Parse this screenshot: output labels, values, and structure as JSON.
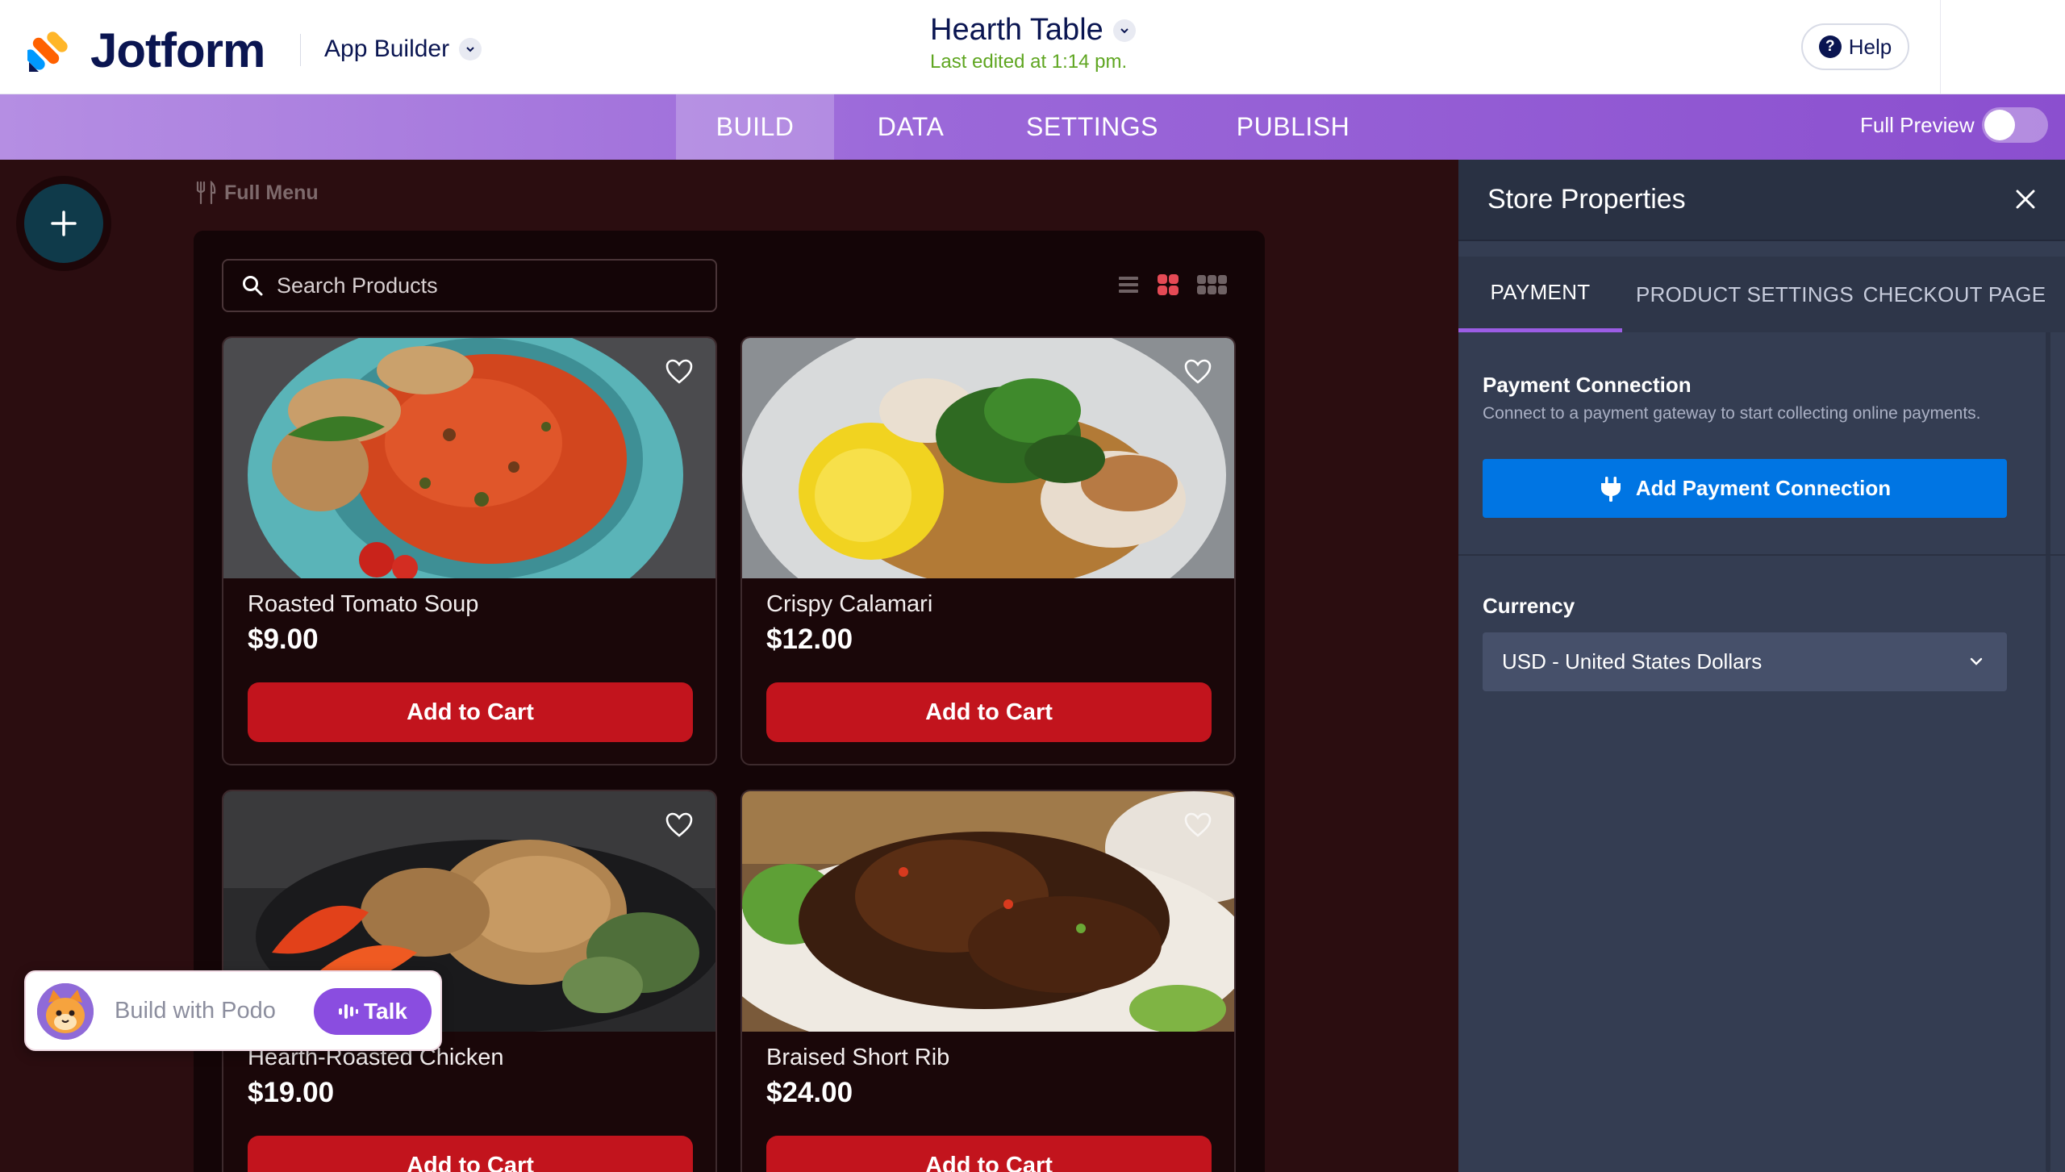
{
  "header": {
    "brand": "Jotform",
    "app_builder_label": "App Builder",
    "app_title": "Hearth Table",
    "last_edited": "Last edited at 1:14 pm.",
    "help_label": "Help"
  },
  "nav": {
    "tabs": [
      {
        "label": "BUILD",
        "active": true
      },
      {
        "label": "DATA",
        "active": false
      },
      {
        "label": "SETTINGS",
        "active": false
      },
      {
        "label": "PUBLISH",
        "active": false
      }
    ],
    "full_preview_label": "Full Preview",
    "full_preview_on": false
  },
  "canvas": {
    "page_label": "Full Menu",
    "search_placeholder": "Search Products",
    "products": [
      {
        "name": "Roasted Tomato Soup",
        "price": "$9.00",
        "button": "Add to Cart"
      },
      {
        "name": "Crispy Calamari",
        "price": "$12.00",
        "button": "Add to Cart"
      },
      {
        "name": "Hearth-Roasted Chicken",
        "price": "$19.00",
        "button": "Add to Cart"
      },
      {
        "name": "Braised Short Rib",
        "price": "$24.00",
        "button": "Add to Cart"
      }
    ]
  },
  "podo": {
    "text": "Build with Podo",
    "talk_label": "Talk"
  },
  "panel": {
    "title": "Store Properties",
    "tabs": [
      {
        "label": "PAYMENT",
        "active": true
      },
      {
        "label": "PRODUCT SETTINGS",
        "active": false
      },
      {
        "label": "CHECKOUT PAGE",
        "active": false
      }
    ],
    "payment_connection": {
      "title": "Payment Connection",
      "description": "Connect to a payment gateway to start collecting online payments.",
      "button": "Add Payment Connection"
    },
    "currency": {
      "title": "Currency",
      "selected": "USD - United States Dollars"
    }
  },
  "colors": {
    "brand_navy": "#0a1551",
    "nav_purple": "#9b68d9",
    "cart_red": "#c2141d",
    "payment_blue": "#0075e3",
    "edited_green": "#5fa621"
  }
}
